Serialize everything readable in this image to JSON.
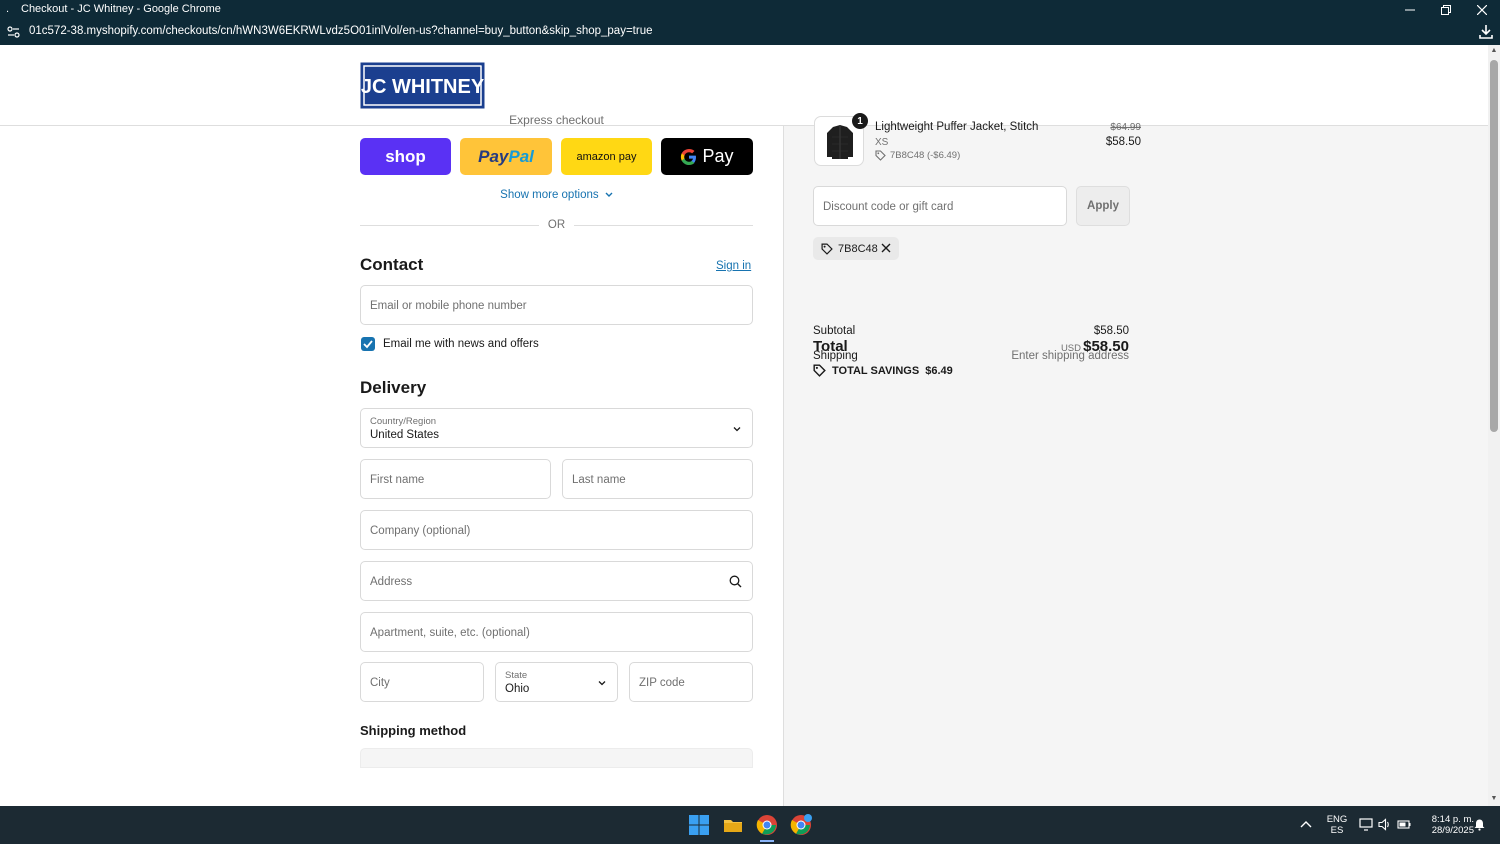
{
  "window": {
    "title": "Checkout - JC Whitney - Google Chrome",
    "url": "01c572-38.myshopify.com/checkouts/cn/hWN3W6EKRWLvdz5O01inlVol/en-us?channel=buy_button&skip_shop_pay=true"
  },
  "header": {
    "logo_text": "JC WHITNEY"
  },
  "express": {
    "title": "Express checkout",
    "shop_label": "shop",
    "paypal_label_1": "Pay",
    "paypal_label_2": "Pal",
    "amazon_label": "amazon pay",
    "gpay_label": "Pay",
    "more_options": "Show more options",
    "or": "OR"
  },
  "contact": {
    "heading": "Contact",
    "signin": "Sign in",
    "email_placeholder": "Email or mobile phone number",
    "newsletter_label": "Email me with news and offers",
    "newsletter_checked": true
  },
  "delivery": {
    "heading": "Delivery",
    "country_label": "Country/Region",
    "country_value": "United States",
    "first_name": "First name",
    "last_name": "Last name",
    "company": "Company (optional)",
    "address": "Address",
    "apartment": "Apartment, suite, etc. (optional)",
    "city": "City",
    "state_label": "State",
    "state_value": "Ohio",
    "zip": "ZIP code"
  },
  "shipping_method": {
    "heading": "Shipping method"
  },
  "summary": {
    "item": {
      "quantity": "1",
      "name": "Lightweight Puffer Jacket, Stitch",
      "variant": "XS",
      "discount": "7B8C48 (-$6.49)",
      "original_price": "$64.99",
      "price": "$58.50"
    },
    "discount_placeholder": "Discount code or gift card",
    "apply": "Apply",
    "applied_code": "7B8C48",
    "subtotal_label": "Subtotal",
    "subtotal_value": "$58.50",
    "shipping_label": "Shipping",
    "shipping_value": "Enter shipping address",
    "total_label": "Total",
    "currency": "USD",
    "total_value": "$58.50",
    "savings_label": "TOTAL SAVINGS",
    "savings_value": "$6.49"
  },
  "taskbar": {
    "lang_1": "ENG",
    "lang_2": "ES",
    "time": "8:14 p. m.",
    "date": "28/9/2025"
  },
  "colors": {
    "accent": "#1773b0",
    "shop_pay": "#5a31f4",
    "paypal": "#ffc439",
    "amazon_pay": "#ffd814",
    "logo_blue": "#1b3f8f"
  }
}
